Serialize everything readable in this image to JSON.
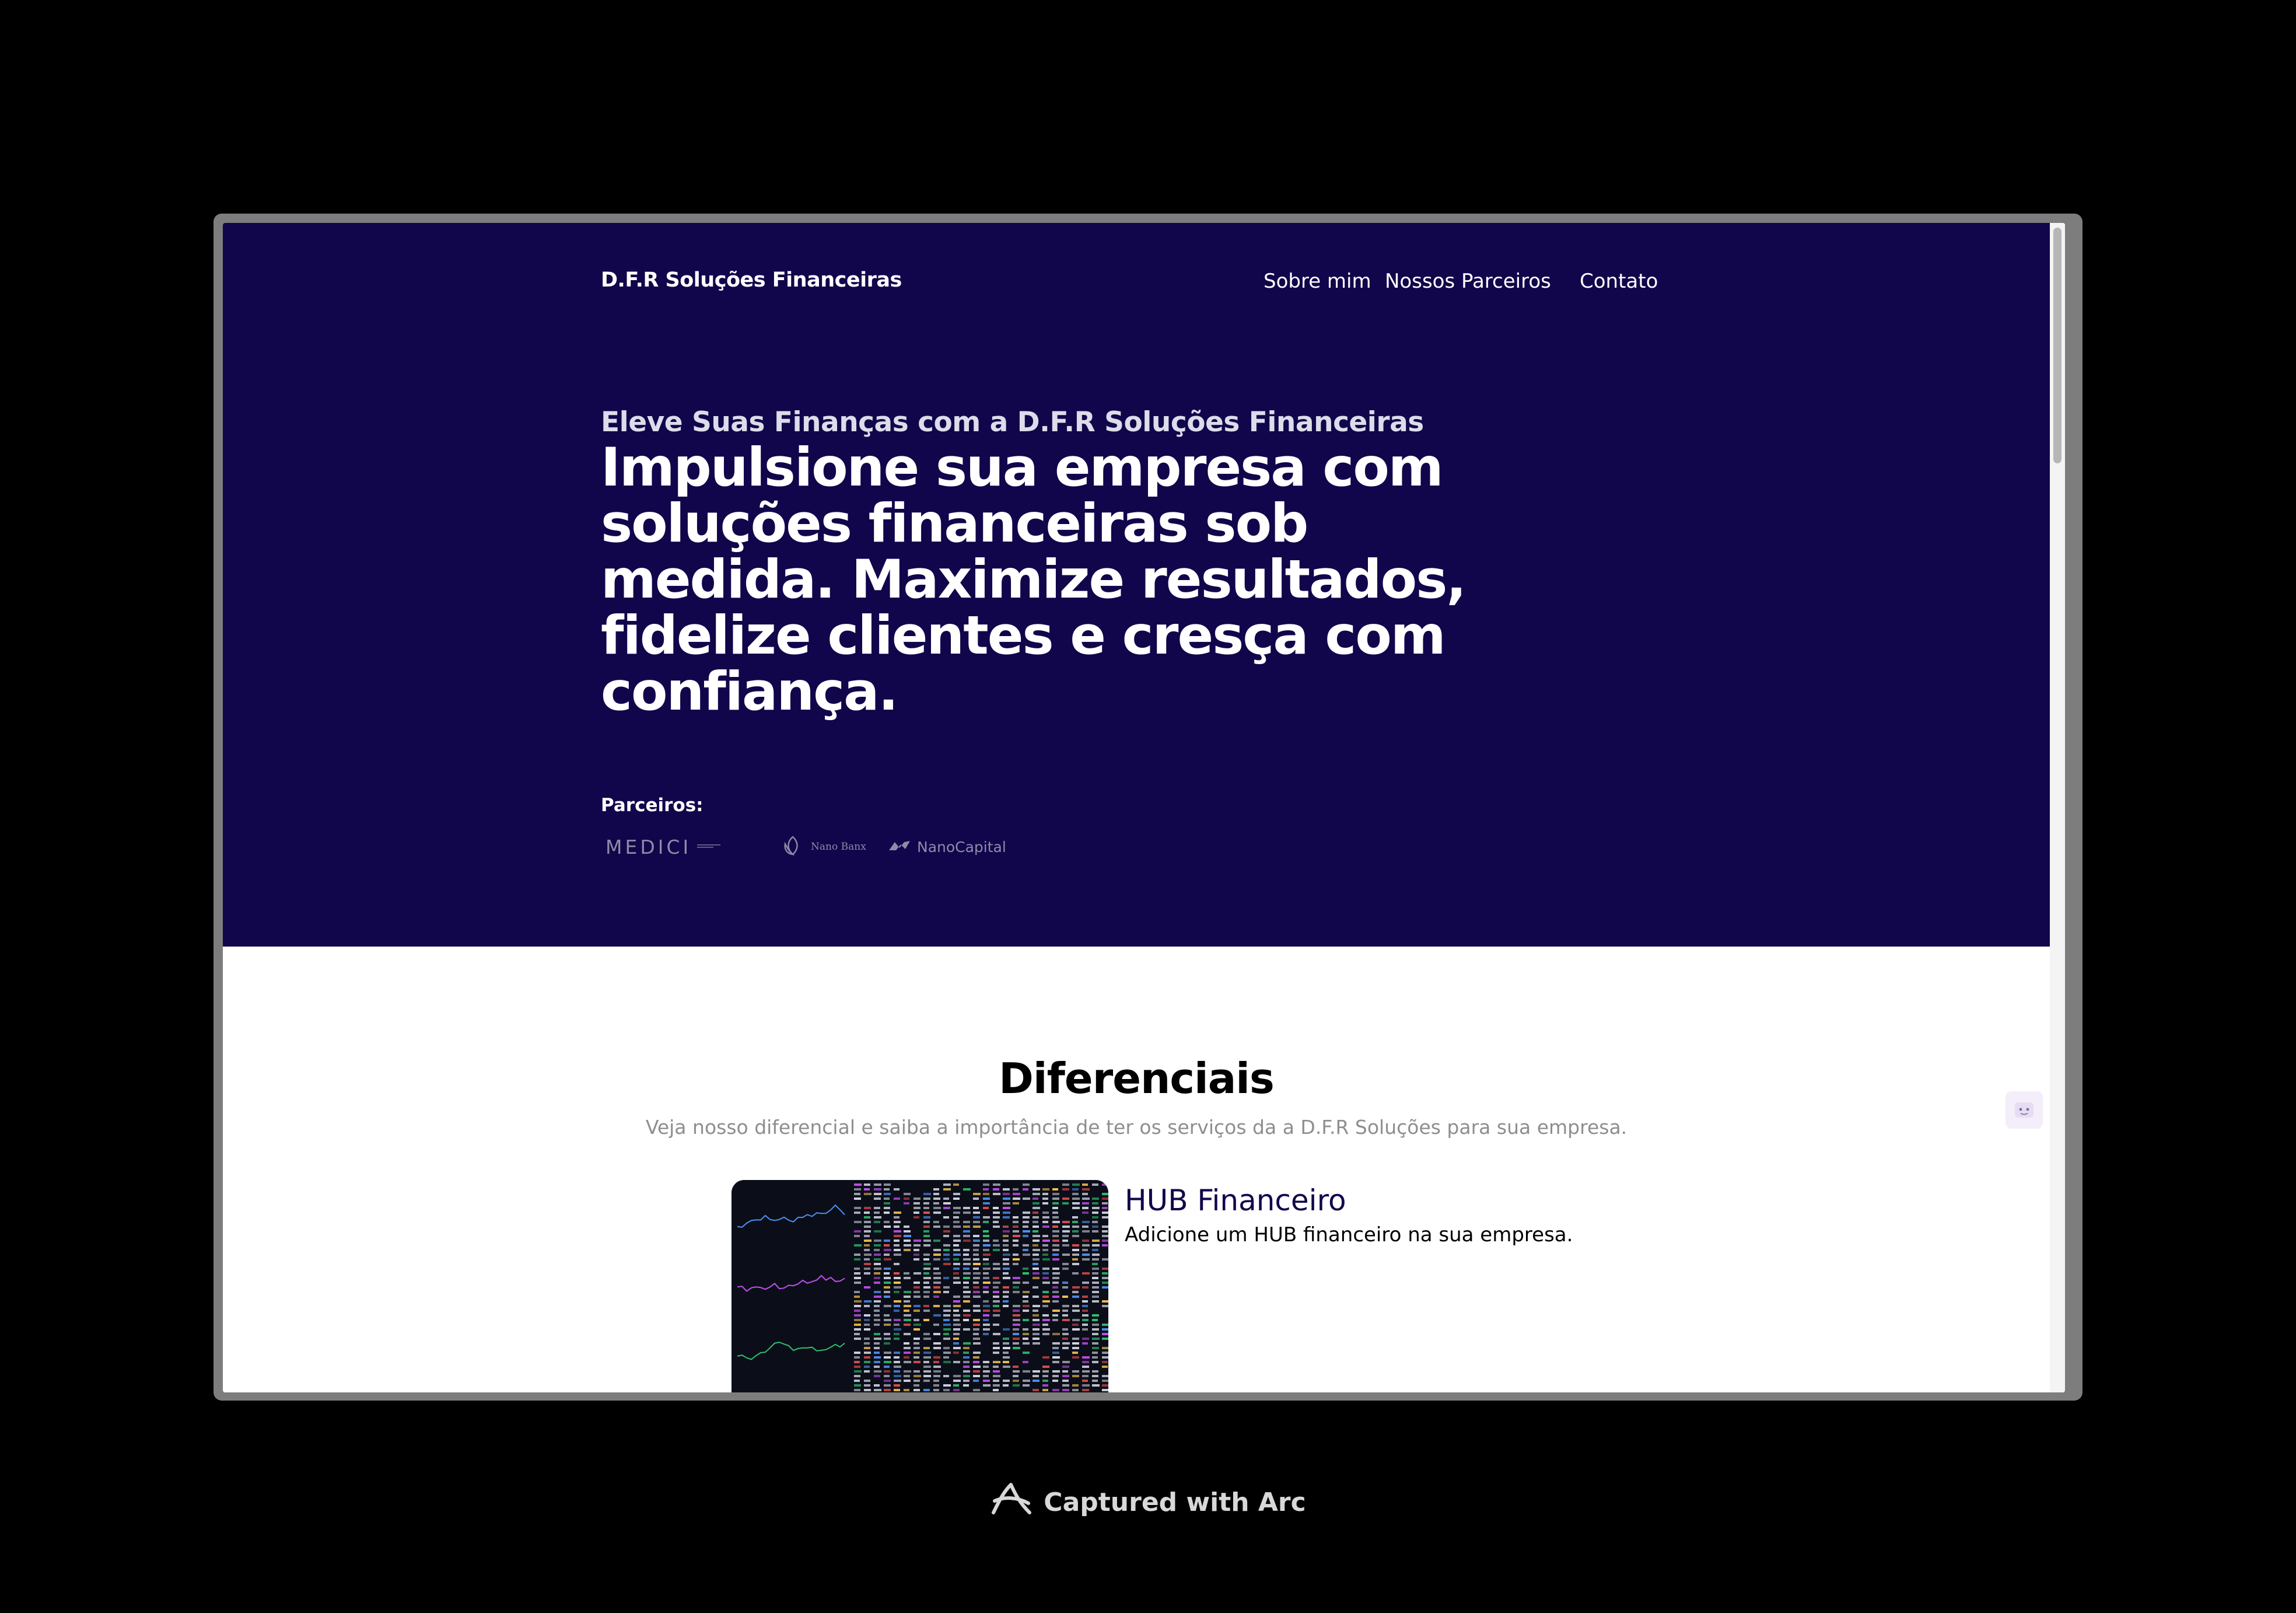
{
  "header": {
    "brand": "D.F.R Soluções Financeiras",
    "nav": [
      "Sobre mim",
      "Nossos Parceiros",
      "Contato"
    ]
  },
  "hero": {
    "eyebrow": "Eleve Suas Finanças com a D.F.R Soluções Financeiras",
    "headline": "Impulsione sua empresa com soluções financeiras sob medida. Maximize resultados, fidelize clientes e cresça com confiança.",
    "partners_label": "Parceiros:",
    "partners": [
      "MEDICI",
      "Nano Banx",
      "NanoCapital"
    ]
  },
  "section": {
    "title": "Diferenciais",
    "subtitle": "Veja nosso diferencial e saiba a importância de ter os serviços da a D.F.R Soluções para sua empresa."
  },
  "card": {
    "title": "HUB Financeiro",
    "description": "Adicione um HUB financeiro na sua empresa."
  },
  "footer": {
    "caption": "Captured with Arc"
  },
  "colors": {
    "hero_bg": "#11064b",
    "accent_title": "#11064b",
    "page_bg": "#000000"
  }
}
